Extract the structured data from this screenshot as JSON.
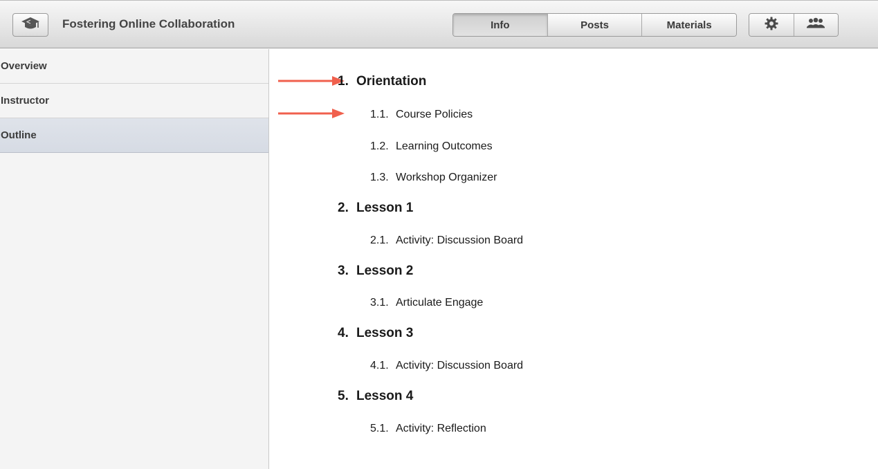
{
  "header": {
    "course_title": "Fostering Online Collaboration",
    "course_icon": "graduation-cap-icon",
    "tabs": [
      {
        "label": "Info",
        "active": true
      },
      {
        "label": "Posts",
        "active": false
      },
      {
        "label": "Materials",
        "active": false
      }
    ],
    "settings_icon": "gear-icon",
    "people_icon": "people-icon"
  },
  "sidebar": {
    "items": [
      {
        "label": "Overview",
        "active": false
      },
      {
        "label": "Instructor",
        "active": false
      },
      {
        "label": "Outline",
        "active": true
      }
    ]
  },
  "outline": {
    "sections": [
      {
        "num": "1.",
        "title": "Orientation",
        "items": [
          {
            "num": "1.1.",
            "title": "Course Policies"
          },
          {
            "num": "1.2.",
            "title": "Learning Outcomes"
          },
          {
            "num": "1.3.",
            "title": "Workshop Organizer"
          }
        ]
      },
      {
        "num": "2.",
        "title": "Lesson 1",
        "items": [
          {
            "num": "2.1.",
            "title": "Activity: Discussion Board"
          }
        ]
      },
      {
        "num": "3.",
        "title": "Lesson 2",
        "items": [
          {
            "num": "3.1.",
            "title": "Articulate Engage"
          }
        ]
      },
      {
        "num": "4.",
        "title": "Lesson 3",
        "items": [
          {
            "num": "4.1.",
            "title": "Activity: Discussion Board"
          }
        ]
      },
      {
        "num": "5.",
        "title": "Lesson 4",
        "items": [
          {
            "num": "5.1.",
            "title": "Activity: Reflection"
          }
        ]
      }
    ]
  },
  "colors": {
    "annotation_arrow": "#f0604d",
    "sidebar_active": "#d9dee7"
  }
}
